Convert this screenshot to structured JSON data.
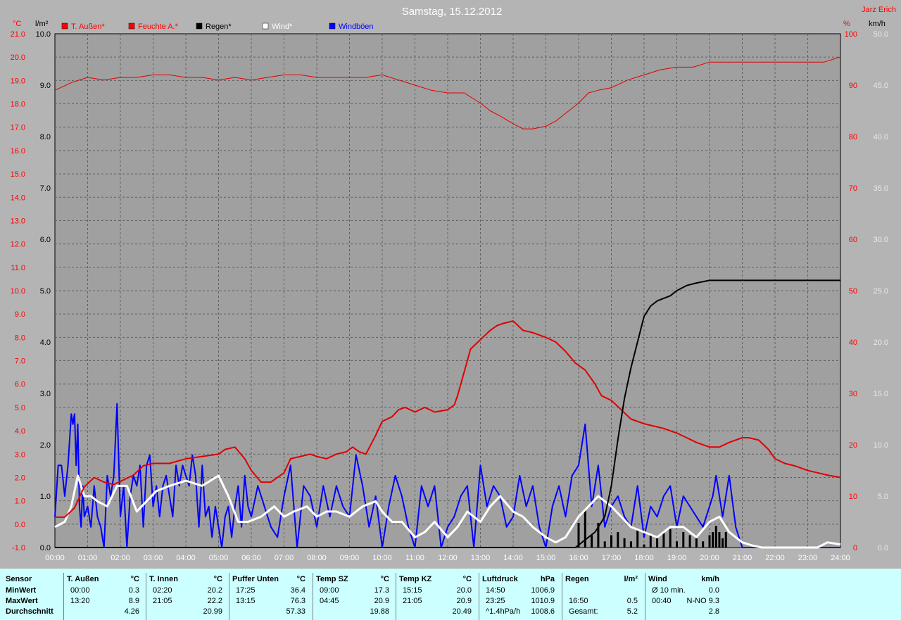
{
  "title": "Samstag, 15.12.2012",
  "author": "Jarz Erich",
  "axis_units": {
    "left_temp": "°C",
    "left_rain": "l/m²",
    "right_hum": "%",
    "right_wind": "km/h"
  },
  "colors": {
    "background": "#b4b4b4",
    "plot": "#a0a0a0",
    "temp": "#ff0000",
    "humidity": "#e00000",
    "rain": "#000000",
    "wind": "#ffffff",
    "gust": "#0000ff",
    "stats_bg": "#ccffff"
  },
  "legend": [
    {
      "label": "T. Außen*",
      "color": "#ff0000"
    },
    {
      "label": "Feuchte A.*",
      "color": "#ff0000"
    },
    {
      "label": "Regen*",
      "color": "#000000"
    },
    {
      "label": "Wind*",
      "color": "#ffffff"
    },
    {
      "label": "Windböen",
      "color": "#0000ff"
    }
  ],
  "chart_data": {
    "type": "line",
    "title": "Samstag, 15.12.2012",
    "x_ticks": [
      "00:00",
      "01:00",
      "02:00",
      "03:00",
      "04:00",
      "05:00",
      "06:00",
      "07:00",
      "08:00",
      "09:00",
      "10:00",
      "11:00",
      "12:00",
      "13:00",
      "14:00",
      "15:00",
      "16:00",
      "17:00",
      "18:00",
      "19:00",
      "20:00",
      "21:00",
      "22:00",
      "23:00",
      "24:00"
    ],
    "axes": {
      "temp": {
        "unit": "°C",
        "range": [
          -1,
          21
        ],
        "ticks": [
          "21.0",
          "20.0",
          "19.0",
          "18.0",
          "17.0",
          "16.0",
          "15.0",
          "14.0",
          "13.0",
          "12.0",
          "11.0",
          "10.0",
          "9.0",
          "8.0",
          "7.0",
          "6.0",
          "5.0",
          "4.0",
          "3.0",
          "2.0",
          "1.0",
          "0.0",
          "-1.0"
        ]
      },
      "rain": {
        "unit": "l/m²",
        "range": [
          0,
          10
        ],
        "ticks": [
          "10.0",
          "9.0",
          "8.0",
          "7.0",
          "6.0",
          "5.0",
          "4.0",
          "3.0",
          "2.0",
          "1.0",
          "0.0"
        ]
      },
      "humidity": {
        "unit": "%",
        "range": [
          0,
          100
        ],
        "ticks": [
          "100",
          "90",
          "80",
          "70",
          "60",
          "50",
          "40",
          "30",
          "20",
          "10",
          "0"
        ]
      },
      "wind": {
        "unit": "km/h",
        "range": [
          0,
          50
        ],
        "ticks": [
          "50.0",
          "45.0",
          "40.0",
          "35.0",
          "30.0",
          "25.0",
          "20.0",
          "15.0",
          "10.0",
          "5.0",
          "0.0"
        ]
      }
    },
    "grid": true,
    "series": [
      {
        "name": "T. Außen*",
        "axis": "temp",
        "x": [
          0,
          0.3,
          0.6,
          0.9,
          1.2,
          1.5,
          1.8,
          2.1,
          2.4,
          2.7,
          3.0,
          3.5,
          4.0,
          4.5,
          5.0,
          5.2,
          5.5,
          5.8,
          6.0,
          6.3,
          6.6,
          7.0,
          7.2,
          7.5,
          7.8,
          8.0,
          8.3,
          8.6,
          8.9,
          9.1,
          9.3,
          9.5,
          9.8,
          10.0,
          10.3,
          10.5,
          10.7,
          11.0,
          11.3,
          11.6,
          12.0,
          12.2,
          12.3,
          12.5,
          12.7,
          13.0,
          13.3,
          13.5,
          13.7,
          14.0,
          14.3,
          14.6,
          15.0,
          15.3,
          15.6,
          15.9,
          16.2,
          16.5,
          16.7,
          17.0,
          17.3,
          17.6,
          18.0,
          18.3,
          18.6,
          19.0,
          19.3,
          19.6,
          20.0,
          20.3,
          20.6,
          21.0,
          21.2,
          21.5,
          21.8,
          22.0,
          22.3,
          22.6,
          23.0,
          23.3,
          23.6,
          24.0
        ],
        "y": [
          0.3,
          0.3,
          0.7,
          1.6,
          2.0,
          1.8,
          1.7,
          1.9,
          2.1,
          2.5,
          2.6,
          2.6,
          2.8,
          2.9,
          3.0,
          3.2,
          3.3,
          2.8,
          2.3,
          1.8,
          1.8,
          2.2,
          2.8,
          2.9,
          3.0,
          2.9,
          2.8,
          3.0,
          3.1,
          3.3,
          3.1,
          3.0,
          3.8,
          4.4,
          4.6,
          4.9,
          5.0,
          4.8,
          5.0,
          4.8,
          4.9,
          5.1,
          5.5,
          6.5,
          7.5,
          7.9,
          8.3,
          8.5,
          8.6,
          8.7,
          8.3,
          8.2,
          8.0,
          7.8,
          7.4,
          6.9,
          6.6,
          6.0,
          5.5,
          5.3,
          4.9,
          4.5,
          4.3,
          4.2,
          4.1,
          3.9,
          3.7,
          3.5,
          3.3,
          3.3,
          3.5,
          3.7,
          3.7,
          3.6,
          3.2,
          2.8,
          2.6,
          2.5,
          2.3,
          2.2,
          2.1,
          2.0
        ]
      },
      {
        "name": "Feuchte A.*",
        "axis": "humidity",
        "x": [
          0,
          0.5,
          1.0,
          1.5,
          2.0,
          2.5,
          3.0,
          3.5,
          4.0,
          4.5,
          5.0,
          5.5,
          6.0,
          6.5,
          7.0,
          7.5,
          8.0,
          8.5,
          9.0,
          9.5,
          10.0,
          10.5,
          11.0,
          11.5,
          12.0,
          12.5,
          13.0,
          13.3,
          13.6,
          14.0,
          14.3,
          14.6,
          15.0,
          15.3,
          15.6,
          16.0,
          16.3,
          16.6,
          17.0,
          17.5,
          18.0,
          18.5,
          19.0,
          19.5,
          20.0,
          20.5,
          21.0,
          22.0,
          23.0,
          23.5,
          24.0
        ],
        "y": [
          89,
          90.5,
          91.5,
          91,
          91.5,
          91.5,
          92,
          92,
          91.5,
          91.5,
          91,
          91.5,
          91,
          91.5,
          92,
          92,
          91.5,
          91.5,
          91.5,
          91.5,
          92,
          91,
          90,
          89,
          88.5,
          88.5,
          86.5,
          85,
          84,
          82.5,
          81.5,
          81.5,
          82,
          83,
          84.5,
          86.5,
          88.5,
          89,
          89.5,
          91,
          92,
          93,
          93.5,
          93.5,
          94.5,
          94.5,
          94.5,
          94.5,
          94.5,
          94.5,
          95.5
        ]
      },
      {
        "name": "Regen*",
        "axis": "rain",
        "x": [
          0,
          15.9,
          16.0,
          16.5,
          16.8,
          17.0,
          17.2,
          17.4,
          17.6,
          17.8,
          18.0,
          18.2,
          18.4,
          18.6,
          18.8,
          19.0,
          19.3,
          19.6,
          20.0,
          20.5,
          21.0,
          22.0,
          23.0,
          24.0
        ],
        "y": [
          0,
          0,
          0.05,
          0.3,
          0.6,
          1.2,
          2.1,
          2.9,
          3.5,
          4.0,
          4.5,
          4.7,
          4.8,
          4.85,
          4.9,
          5.0,
          5.1,
          5.15,
          5.2,
          5.2,
          5.2,
          5.2,
          5.2,
          5.2
        ]
      },
      {
        "name": "Wind*",
        "axis": "wind",
        "x": [
          0,
          0.3,
          0.5,
          0.7,
          0.9,
          1.1,
          1.3,
          1.6,
          1.9,
          2.2,
          2.5,
          2.8,
          3.1,
          3.5,
          4.0,
          4.5,
          5.0,
          5.3,
          5.6,
          5.9,
          6.3,
          6.7,
          7.0,
          7.3,
          7.7,
          8.0,
          8.3,
          8.6,
          9.0,
          9.4,
          9.8,
          10.0,
          10.3,
          10.6,
          11.0,
          11.3,
          11.6,
          12.0,
          12.3,
          12.6,
          13.0,
          13.3,
          13.6,
          14.0,
          14.3,
          14.6,
          15.0,
          15.3,
          15.6,
          16.0,
          16.3,
          16.6,
          17.0,
          17.3,
          17.6,
          18.0,
          18.4,
          18.8,
          19.2,
          19.6,
          20.0,
          20.3,
          20.6,
          21.0,
          21.3,
          21.6,
          22.0,
          22.5,
          23.0,
          23.3,
          23.6,
          24.0
        ],
        "y": [
          2,
          2.5,
          4,
          7,
          5,
          5,
          4.5,
          4,
          6,
          6,
          3.5,
          4.5,
          5.5,
          6,
          6.5,
          6,
          7,
          5,
          2.5,
          2.5,
          3,
          4,
          3,
          3.5,
          4,
          3,
          3.5,
          3.5,
          3,
          4,
          4.5,
          3.5,
          2.5,
          2.5,
          1,
          1.5,
          2.5,
          1,
          2,
          3.5,
          2.5,
          4,
          5,
          3.5,
          3,
          2,
          1,
          0.5,
          1,
          3,
          4,
          5,
          4,
          3,
          2,
          1.5,
          1,
          2,
          2,
          1,
          2.5,
          3,
          1.5,
          0.5,
          0.2,
          0,
          0,
          0,
          0,
          0,
          0.5,
          0.3
        ]
      },
      {
        "name": "Windböen",
        "axis": "wind",
        "x": [
          0,
          0.1,
          0.2,
          0.3,
          0.4,
          0.5,
          0.55,
          0.6,
          0.65,
          0.7,
          0.75,
          0.8,
          0.85,
          0.9,
          1.0,
          1.1,
          1.2,
          1.3,
          1.4,
          1.5,
          1.6,
          1.7,
          1.8,
          1.9,
          2.0,
          2.1,
          2.2,
          2.3,
          2.4,
          2.5,
          2.6,
          2.7,
          2.8,
          2.9,
          3.0,
          3.1,
          3.2,
          3.3,
          3.4,
          3.5,
          3.6,
          3.7,
          3.8,
          3.9,
          4.0,
          4.1,
          4.2,
          4.3,
          4.4,
          4.5,
          4.6,
          4.7,
          4.8,
          4.9,
          5.0,
          5.1,
          5.2,
          5.3,
          5.4,
          5.5,
          5.6,
          5.7,
          5.8,
          5.9,
          6.0,
          6.2,
          6.4,
          6.6,
          6.8,
          7.0,
          7.2,
          7.4,
          7.6,
          7.8,
          8.0,
          8.2,
          8.4,
          8.6,
          8.8,
          9.0,
          9.2,
          9.4,
          9.6,
          9.8,
          10.0,
          10.2,
          10.4,
          10.6,
          10.8,
          11.0,
          11.2,
          11.4,
          11.6,
          11.8,
          12.0,
          12.2,
          12.4,
          12.6,
          12.8,
          13.0,
          13.2,
          13.4,
          13.6,
          13.8,
          14.0,
          14.2,
          14.4,
          14.6,
          14.8,
          15.0,
          15.2,
          15.4,
          15.6,
          15.8,
          16.0,
          16.2,
          16.4,
          16.6,
          16.8,
          17.0,
          17.2,
          17.4,
          17.6,
          17.8,
          18.0,
          18.2,
          18.4,
          18.6,
          18.8,
          19.0,
          19.2,
          19.4,
          19.6,
          19.8,
          20.0,
          20.1,
          20.2,
          20.3,
          20.4,
          20.5,
          20.6,
          20.8,
          21.0,
          24.0
        ],
        "y": [
          3,
          8,
          8,
          5,
          8,
          13,
          12,
          13,
          8,
          12,
          4,
          2,
          6,
          3,
          4,
          2,
          6,
          3,
          2,
          0,
          7,
          5,
          7,
          14,
          3,
          6,
          0,
          5,
          7,
          6,
          8,
          2,
          8,
          9,
          4,
          6,
          3,
          6,
          7,
          5,
          3,
          8,
          6,
          8,
          7,
          6,
          9,
          7,
          2,
          8,
          3,
          4,
          1,
          4,
          2,
          0,
          3,
          4,
          1,
          4,
          6,
          2,
          7,
          4,
          3,
          6,
          4,
          2,
          1,
          5,
          8,
          0,
          6,
          5,
          2,
          6,
          3,
          6,
          4,
          3,
          9,
          6,
          2,
          5,
          0,
          4,
          7,
          5,
          2,
          0,
          6,
          4,
          6,
          0,
          2,
          3,
          5,
          6,
          0,
          8,
          4,
          6,
          5,
          2,
          3,
          7,
          4,
          6,
          2,
          0,
          4,
          6,
          3,
          7,
          8,
          12,
          4,
          8,
          2,
          4,
          5,
          3,
          2,
          6,
          1,
          4,
          3,
          5,
          6,
          2,
          5,
          4,
          3,
          2,
          4,
          5,
          7,
          5,
          3,
          5,
          7,
          2,
          0,
          0
        ]
      }
    ]
  },
  "stats": {
    "columns": [
      {
        "name": "Sensor",
        "unit": "",
        "rows": [
          "MinWert",
          "MaxWert",
          "Durchschnitt"
        ]
      },
      {
        "name": "T. Außen",
        "unit": "°C",
        "rows": [
          [
            "00:00",
            "0.3"
          ],
          [
            "13:20",
            "8.9"
          ],
          [
            "",
            "4.26"
          ]
        ]
      },
      {
        "name": "T. Innen",
        "unit": "°C",
        "rows": [
          [
            "02:20",
            "20.2"
          ],
          [
            "21:05",
            "22.2"
          ],
          [
            "",
            "20.99"
          ]
        ]
      },
      {
        "name": "Puffer Unten",
        "unit": "°C",
        "rows": [
          [
            "17:25",
            "36.4"
          ],
          [
            "13:15",
            "76.3"
          ],
          [
            "",
            "57.33"
          ]
        ]
      },
      {
        "name": "Temp SZ",
        "unit": "°C",
        "rows": [
          [
            "09:00",
            "17.3"
          ],
          [
            "04:45",
            "20.9"
          ],
          [
            "",
            "19.88"
          ]
        ]
      },
      {
        "name": "Temp KZ",
        "unit": "°C",
        "rows": [
          [
            "15:15",
            "20.0"
          ],
          [
            "21:05",
            "20.9"
          ],
          [
            "",
            "20.49"
          ]
        ]
      },
      {
        "name": "Luftdruck",
        "unit": "hPa",
        "rows": [
          [
            "14:50",
            "1006.9"
          ],
          [
            "23:25",
            "1010.9"
          ],
          [
            "^1.4hPa/h",
            "1008.6"
          ]
        ]
      },
      {
        "name": "Regen",
        "unit": "l/m²",
        "rows": [
          [
            "",
            ""
          ],
          [
            "16:50",
            "0.5"
          ],
          [
            "Gesamt:",
            "5.2"
          ]
        ]
      },
      {
        "name": "Wind",
        "unit": "km/h",
        "rows": [
          [
            "Ø 10 min.",
            "0.0"
          ],
          [
            "00:40",
            "N-NO 9.3"
          ],
          [
            "",
            "2.8"
          ]
        ]
      }
    ]
  }
}
